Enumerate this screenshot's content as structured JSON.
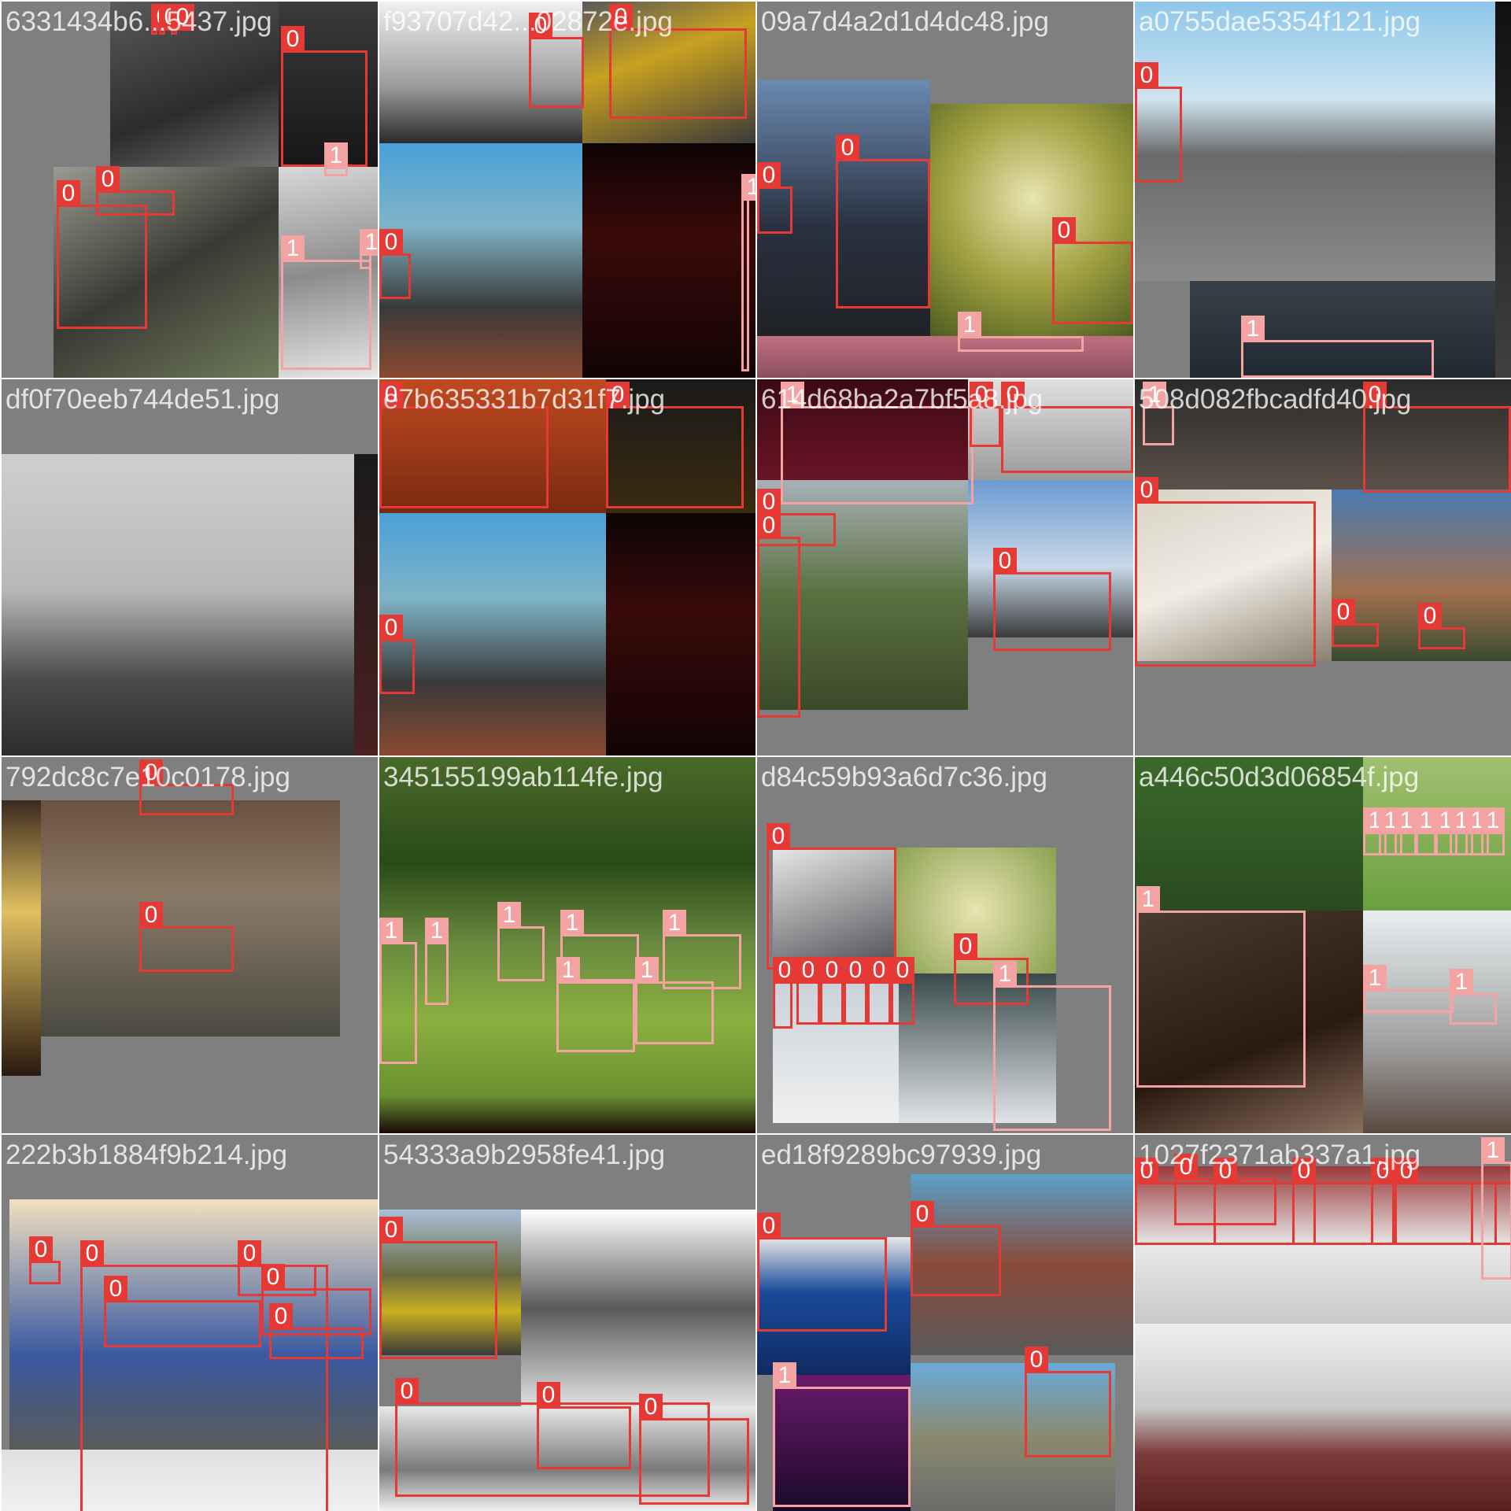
{
  "colors": {
    "class0": "#e53935",
    "class1": "#f4a3a3",
    "background": "#7f7f7f"
  },
  "tiles": [
    {
      "filename": "6331434b6...5437.jpg"
    },
    {
      "filename": "f93707d42...02872e.jpg"
    },
    {
      "filename": "09a7d4a2d1d4dc48.jpg"
    },
    {
      "filename": "a0755dae5354f121.jpg"
    },
    {
      "filename": "df0f70eeb744de51.jpg"
    },
    {
      "filename": "e7b635331b7d31f7.jpg"
    },
    {
      "filename": "614d68ba2a7bf5a8.jpg"
    },
    {
      "filename": "508d082fbcadfd40.jpg"
    },
    {
      "filename": "792dc8c7e10c0178.jpg"
    },
    {
      "filename": "345155199ab114fe.jpg"
    },
    {
      "filename": "d84c59b93a6d7c36.jpg"
    },
    {
      "filename": "a446c50d3d06854f.jpg"
    },
    {
      "filename": "222b3b1884f9b214.jpg"
    },
    {
      "filename": "54333a9b2958fe41.jpg"
    },
    {
      "filename": "ed18f9289bc97939.jpg"
    },
    {
      "filename": "1027f2371ab337a1.jpg"
    }
  ]
}
